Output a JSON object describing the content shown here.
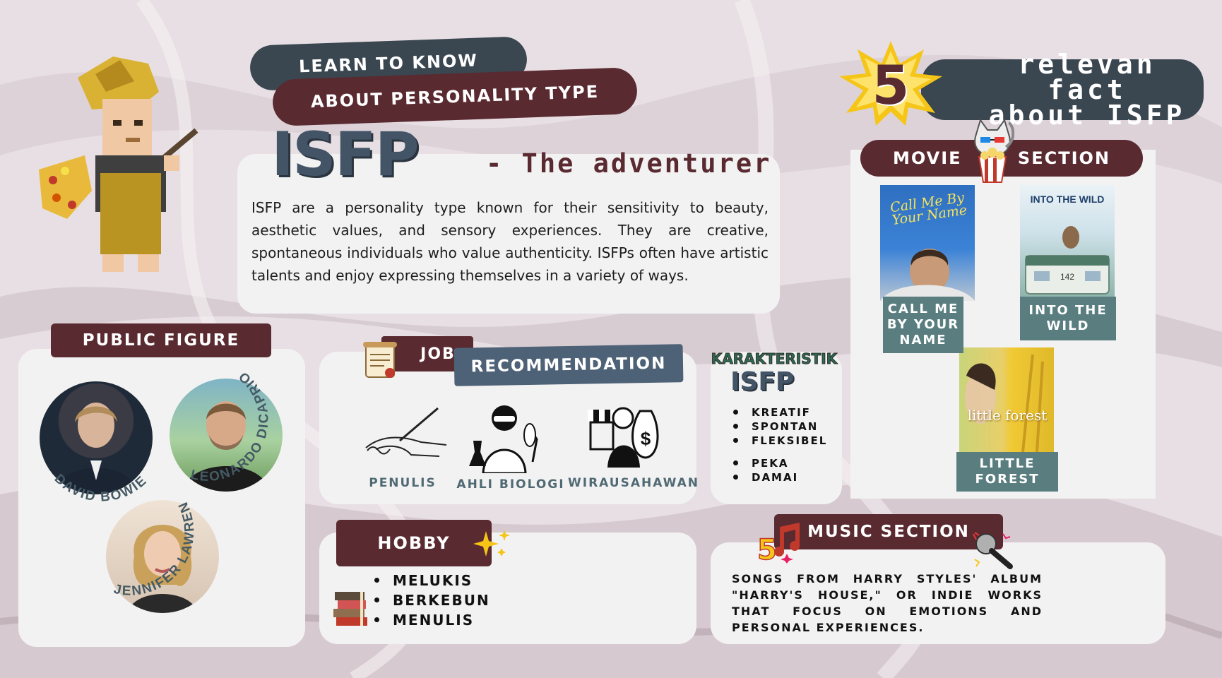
{
  "header": {
    "learn_label": "LEARN TO KNOW",
    "about_label": "ABOUT PERSONALITY TYPE",
    "type_code": "ISFP",
    "subtitle": "- The adventurer"
  },
  "description": "ISFP are a personality type known for their sensitivity to beauty, aesthetic values, and sensory experiences. They are creative, spontaneous individuals who value authenticity. ISFPs often have artistic talents and enjoy expressing themselves in a variety of ways.",
  "facts": {
    "number": "5",
    "title_line1": "relevan fact",
    "title_line2": "about ISFP"
  },
  "public_figure": {
    "title": "PUBLIC FIGURE",
    "people": [
      "DAVID BOWIE",
      "LEONARDO DICAPRIO",
      "JENNIFER LAWRENCE"
    ]
  },
  "job": {
    "title": "JOB",
    "subtitle": "RECOMMENDATION",
    "items": [
      "PENULIS",
      "AHLI BIOLOGI",
      "WIRAUSAHAWAN"
    ]
  },
  "karakteristik": {
    "title": "KARAKTERISTIK",
    "type": "ISFP",
    "items": [
      "KREATIF",
      "SPONTAN",
      "FLEKSIBEL",
      "PEKA",
      "DAMAI"
    ]
  },
  "hobby": {
    "title": "HOBBY",
    "items": [
      "MELUKIS",
      "BERKEBUN",
      "MENULIS"
    ]
  },
  "movies": {
    "title_left": "MOVIE",
    "title_right": "SECTION",
    "items": [
      {
        "caption": "CALL ME BY YOUR NAME",
        "poster_title": "Call Me By Your Name"
      },
      {
        "caption": "INTO THE WILD",
        "poster_title": "INTO THE WILD",
        "poster_number": "142"
      },
      {
        "caption": "LITTLE FOREST",
        "poster_title": "little forest"
      }
    ]
  },
  "music": {
    "title": "MUSIC SECTION",
    "text": "SONGS FROM HARRY STYLES' ALBUM \"HARRY'S HOUSE,\" OR INDIE WORKS THAT FOCUS ON EMOTIONS AND PERSONAL EXPERIENCES."
  },
  "colors": {
    "dark": "#3a4650",
    "maroon": "#5a2a31",
    "slate": "#4e6277",
    "teal": "#5a7e80",
    "card": "#f3f2f2",
    "background": "#e6dde2"
  }
}
